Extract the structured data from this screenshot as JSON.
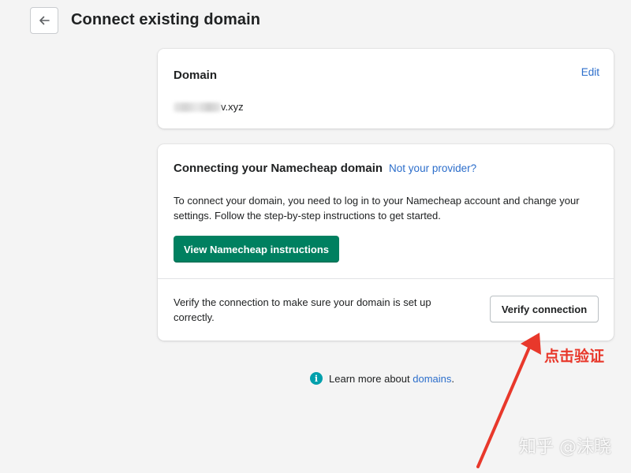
{
  "header": {
    "title": "Connect existing domain",
    "back_icon": "arrow-left-icon"
  },
  "domain_card": {
    "heading": "Domain",
    "edit_label": "Edit",
    "domain_suffix": "v.xyz"
  },
  "connect_card": {
    "heading": "Connecting your Namecheap domain",
    "provider_link": "Not your provider?",
    "instructions": "To connect your domain, you need to log in to your Namecheap account and change your settings. Follow the step-by-step instructions to get started.",
    "instructions_button": "View Namecheap instructions",
    "verify_text": "Verify the connection to make sure your domain is set up correctly.",
    "verify_button": "Verify connection"
  },
  "footer": {
    "learn_prefix": "Learn more about ",
    "learn_link": "domains",
    "learn_suffix": ".",
    "info_icon": "info-icon"
  },
  "annotation": {
    "label": "点击验证",
    "color": "#e8382b"
  },
  "watermark": {
    "text": "知乎 @沫晓"
  },
  "colors": {
    "primary": "#008060",
    "link": "#2c6ecb",
    "background": "#f4f4f4"
  }
}
